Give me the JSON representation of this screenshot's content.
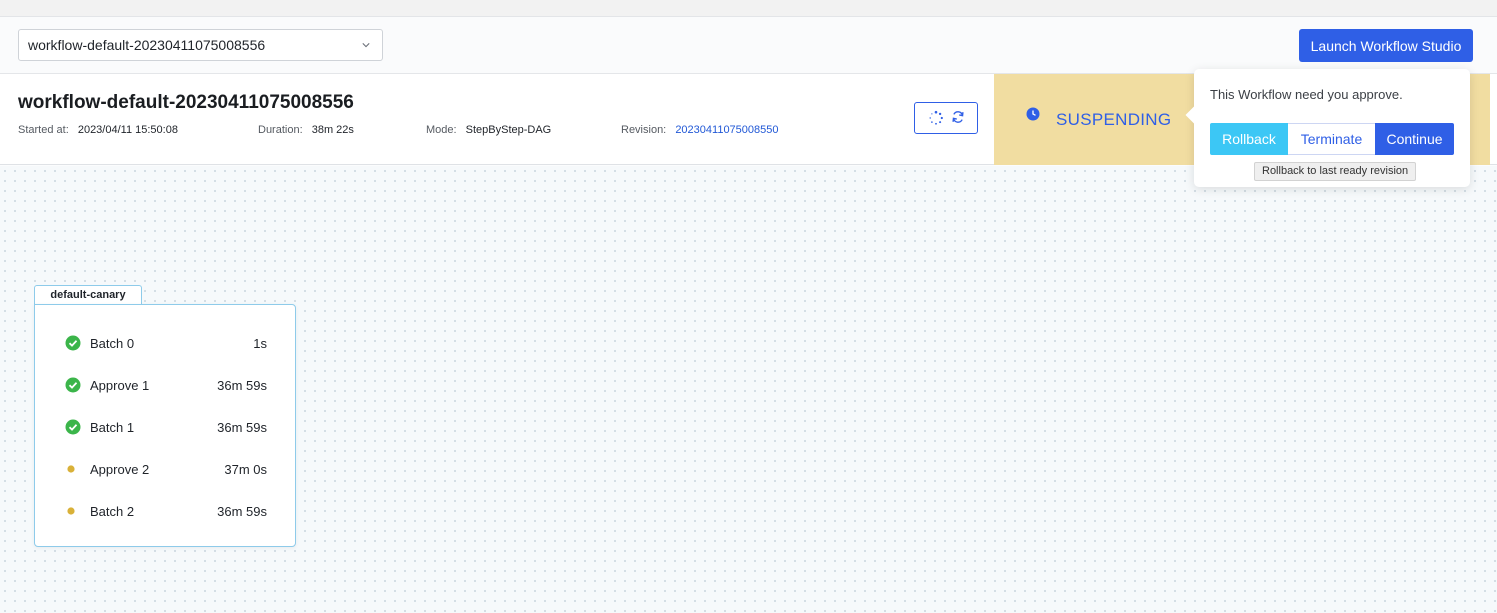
{
  "workflow_select": {
    "value": "workflow-default-20230411075008556"
  },
  "launch_button": "Launch Workflow Studio",
  "header": {
    "title": "workflow-default-20230411075008556",
    "started_at_label": "Started at:",
    "started_at_value": "2023/04/11 15:50:08",
    "duration_label": "Duration:",
    "duration_value": "38m 22s",
    "mode_label": "Mode:",
    "mode_value": "StepByStep-DAG",
    "revision_label": "Revision:",
    "revision_value": "20230411075008550"
  },
  "status": {
    "text": "SUSPENDING",
    "color": "#2f5fe6",
    "background": "#f1dda1"
  },
  "popover": {
    "message": "This Workflow need you approve.",
    "rollback_label": "Rollback",
    "terminate_label": "Terminate",
    "continue_label": "Continue",
    "tooltip": "Rollback to last ready revision"
  },
  "group": {
    "name": "default-canary",
    "steps": [
      {
        "name": "Batch 0",
        "duration": "1s",
        "state": "succeeded"
      },
      {
        "name": "Approve 1",
        "duration": "36m 59s",
        "state": "succeeded"
      },
      {
        "name": "Batch 1",
        "duration": "36m 59s",
        "state": "succeeded"
      },
      {
        "name": "Approve 2",
        "duration": "37m 0s",
        "state": "pending"
      },
      {
        "name": "Batch 2",
        "duration": "36m 59s",
        "state": "pending"
      }
    ]
  },
  "colors": {
    "accent": "#2f5fe6",
    "success": "#3bb54a",
    "pending": "#d9b138",
    "rollback": "#3cc7f5"
  }
}
